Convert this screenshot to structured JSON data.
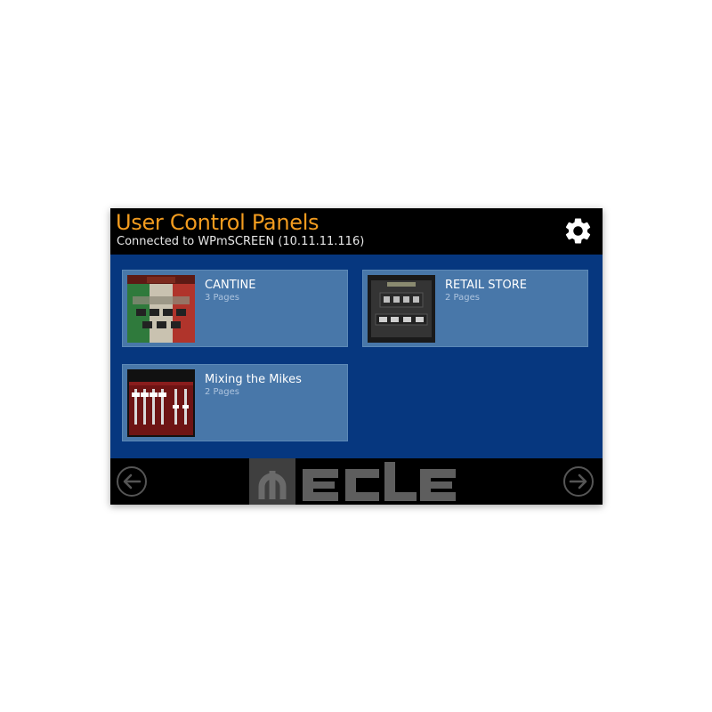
{
  "header": {
    "title": "User Control Panels",
    "subtitle": "Connected to WPmSCREEN (10.11.11.116)",
    "settings_icon": "gear-icon"
  },
  "panels": [
    {
      "name": "CANTINE",
      "pages": "3 Pages",
      "thumbnail": "cantine-panel-thumbnail"
    },
    {
      "name": "RETAIL STORE",
      "pages": "2 Pages",
      "thumbnail": "retail-store-panel-thumbnail"
    },
    {
      "name": "Mixing the Mikes",
      "pages": "2 Pages",
      "thumbnail": "mixing-panel-thumbnail"
    }
  ],
  "footer": {
    "logo_text": "ecler",
    "prev_icon": "arrow-left-icon",
    "next_icon": "arrow-right-icon"
  },
  "colors": {
    "title": "#f39c1f",
    "content_background": "#06377f",
    "tile_background": "#4877a9",
    "screen_background": "#000000"
  }
}
